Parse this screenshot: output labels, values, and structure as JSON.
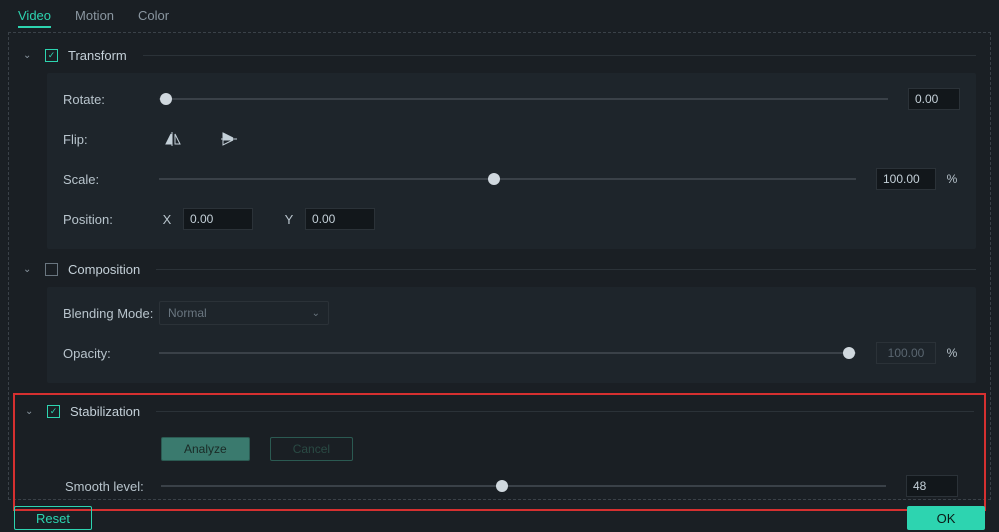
{
  "tabs": {
    "video": "Video",
    "motion": "Motion",
    "color": "Color"
  },
  "transform": {
    "title": "Transform",
    "rotate_label": "Rotate:",
    "rotate_value": "0.00",
    "flip_label": "Flip:",
    "scale_label": "Scale:",
    "scale_value": "100.00",
    "scale_unit": "%",
    "position_label": "Position:",
    "pos_x_label": "X",
    "pos_x_value": "0.00",
    "pos_y_label": "Y",
    "pos_y_value": "0.00"
  },
  "composition": {
    "title": "Composition",
    "blending_label": "Blending Mode:",
    "blending_value": "Normal",
    "opacity_label": "Opacity:",
    "opacity_value": "100.00",
    "opacity_unit": "%"
  },
  "stabilization": {
    "title": "Stabilization",
    "analyze": "Analyze",
    "cancel": "Cancel",
    "smooth_label": "Smooth level:",
    "smooth_value": "48"
  },
  "footer": {
    "reset": "Reset",
    "ok": "OK"
  }
}
